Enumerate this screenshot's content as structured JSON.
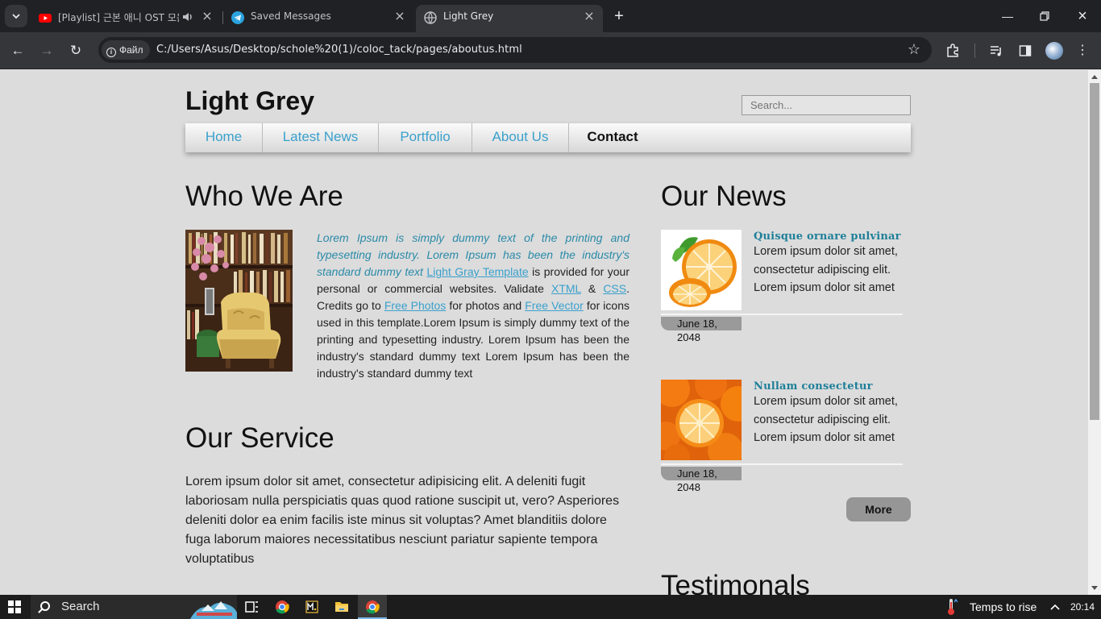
{
  "browser": {
    "tabs": [
      {
        "title": "[Playlist] 근본 애니 OST 모음",
        "icon": "youtube-icon",
        "audio": true
      },
      {
        "title": "Saved Messages",
        "icon": "telegram-icon"
      },
      {
        "title": "Light Grey",
        "icon": "globe-icon",
        "active": true
      }
    ],
    "site_chip": "Файл",
    "url": "C:/Users/Asus/Desktop/schole%20(1)/coloc_tack/pages/aboutus.html"
  },
  "page": {
    "site_title": "Light Grey",
    "search_placeholder": "Search...",
    "menu": [
      {
        "label": "Home"
      },
      {
        "label": "Latest News"
      },
      {
        "label": "Portfolio"
      },
      {
        "label": "About Us"
      },
      {
        "label": "Contact",
        "current": true
      }
    ],
    "who_we_are": {
      "heading": "Who We Are",
      "italic_text": "Lorem Ipsum is simply dummy text of the printing and typesetting industry. Lorem Ipsum has been the industry's standard dummy text",
      "link_template": "Light Gray Template",
      "text_1": " is provided for your personal or commercial websites. Validate ",
      "link_xtml": "XTML",
      "amp": " & ",
      "link_css": "CSS",
      "text_2": ". Credits go to ",
      "link_photos": "Free Photos",
      "text_3": " for photos and ",
      "link_vector": "Free Vector",
      "text_4": " for icons used in this template.Lorem Ipsum is simply dummy text of the printing and typesetting industry. Lorem Ipsum has been the industry's standard dummy text Lorem Ipsum has been the industry's standard dummy text"
    },
    "our_service": {
      "heading": "Our Service",
      "text": "Lorem ipsum dolor sit amet, consectetur adipisicing elit. A deleniti fugit laboriosam nulla perspiciatis quas quod ratione suscipit ut, vero? Asperiores deleniti dolor ea enim facilis iste minus sit voluptas? Amet blanditiis dolore fuga laborum maiores necessitatibus nesciunt pariatur sapiente tempora voluptatibus"
    },
    "our_news": {
      "heading": "Our News",
      "items": [
        {
          "title": "Quisque ornare pulvinar",
          "body": "Lorem ipsum dolor sit amet, consectetur adipiscing elit. Lorem ipsum dolor sit amet",
          "date": "June 18, 2048"
        },
        {
          "title": "Nullam consectetur",
          "body": "Lorem ipsum dolor sit amet, consectetur adipiscing elit. Lorem ipsum dolor sit amet",
          "date": "June 18, 2048"
        }
      ],
      "more_label": "More"
    },
    "testimonials_heading": "Testimonals"
  },
  "taskbar": {
    "search_label": "Search",
    "weather": "Temps to rise",
    "time": "20:14"
  }
}
